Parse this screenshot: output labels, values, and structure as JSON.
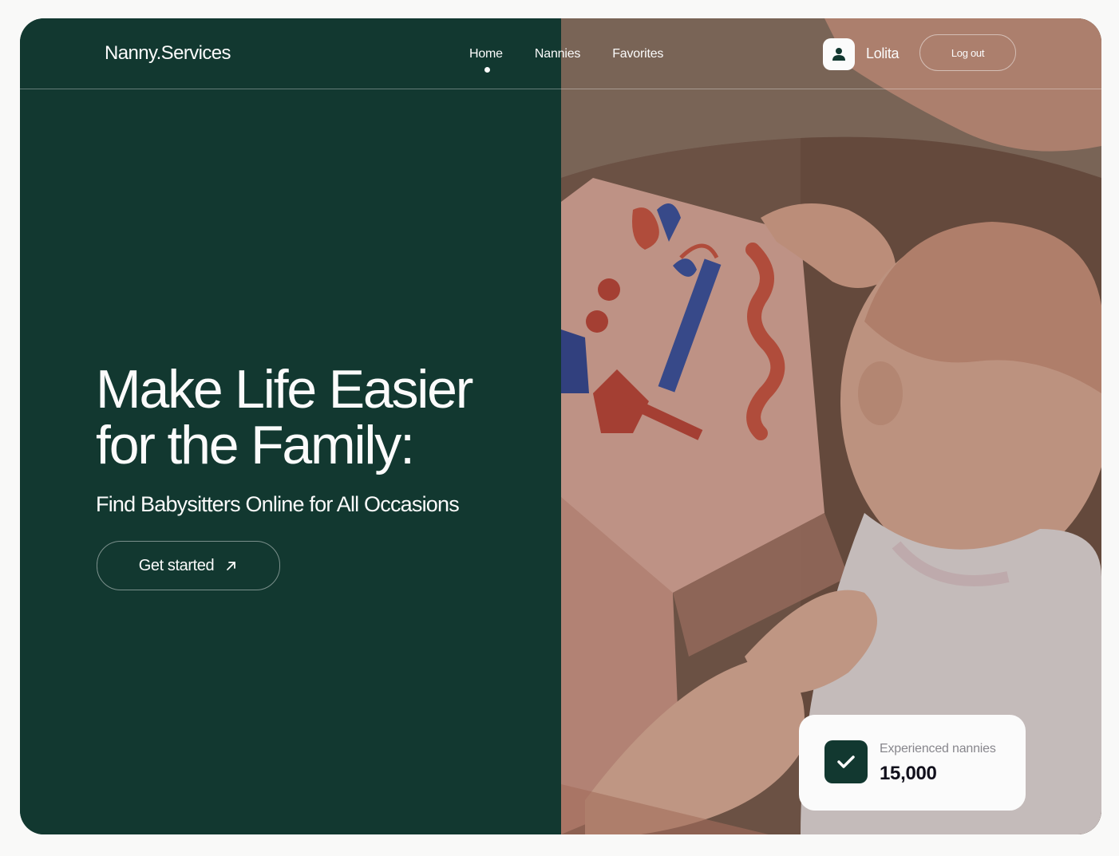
{
  "brand": {
    "logo": "Nanny.Services"
  },
  "nav": {
    "items": [
      {
        "label": "Home",
        "active": true
      },
      {
        "label": "Nannies",
        "active": false
      },
      {
        "label": "Favorites",
        "active": false
      }
    ]
  },
  "user": {
    "name": "Lolita",
    "avatar_icon": "user-icon",
    "logout_label": "Log out"
  },
  "hero": {
    "title": "Make Life Easier for the Family:",
    "subtitle": "Find Babysitters Online for All Occasions",
    "cta_label": "Get started",
    "cta_icon": "arrow-up-right-icon",
    "image_description": "Baby looking at a picture book with an adult"
  },
  "stats": {
    "icon": "check-icon",
    "label": "Experienced nannies",
    "value": "15,000"
  },
  "colors": {
    "primary": "#123830",
    "light": "#fbfbfb",
    "dark_text": "#11101c"
  }
}
